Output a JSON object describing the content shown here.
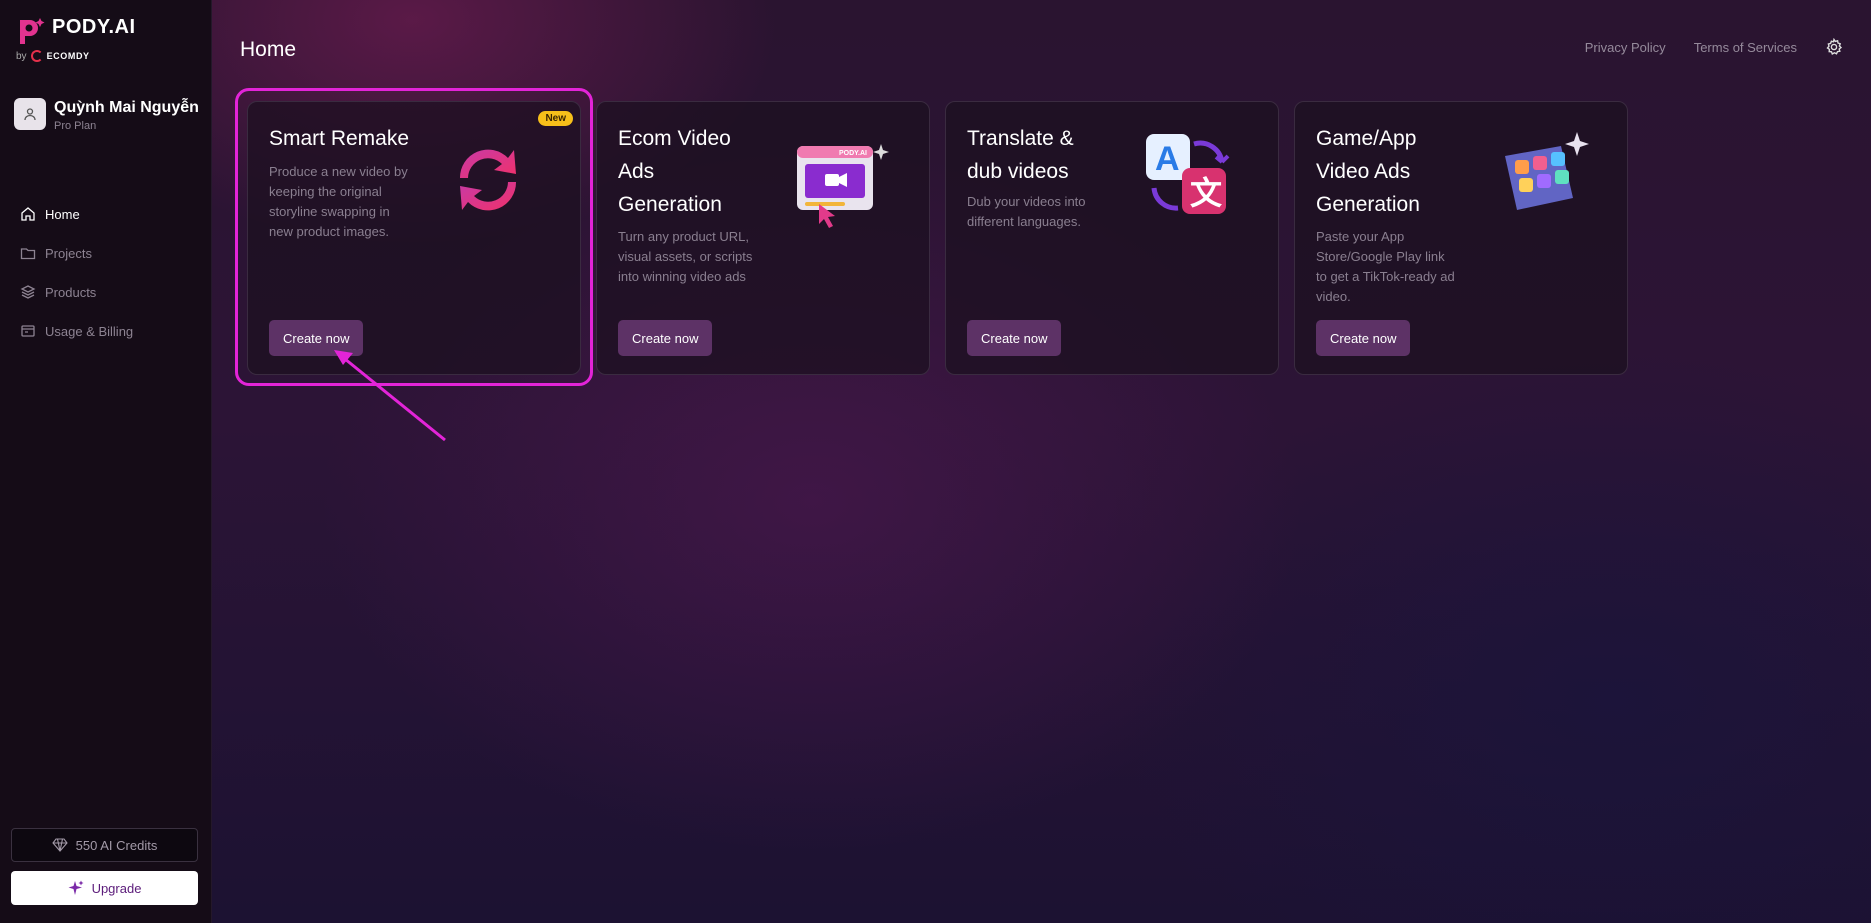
{
  "brand": {
    "name": "PODY.AI",
    "by": "by",
    "company": "ECOMDY"
  },
  "user": {
    "name": "Quỳnh Mai Nguyễn",
    "plan": "Pro Plan"
  },
  "nav": [
    {
      "label": "Home",
      "icon": "home-icon"
    },
    {
      "label": "Projects",
      "icon": "folder-icon"
    },
    {
      "label": "Products",
      "icon": "layers-icon"
    },
    {
      "label": "Usage & Billing",
      "icon": "billing-icon"
    }
  ],
  "credits": {
    "label": "550 AI Credits"
  },
  "upgrade": {
    "label": "Upgrade"
  },
  "header": {
    "title": "Home",
    "privacy": "Privacy Policy",
    "terms": "Terms of Services"
  },
  "cards": [
    {
      "title": "Smart Remake",
      "badge": "New",
      "desc": "Produce a new video by keeping the original storyline swapping in new product images.",
      "button": "Create now"
    },
    {
      "title": "Ecom Video Ads Generation",
      "desc": "Turn any product URL, visual assets, or scripts into winning video ads",
      "button": "Create now"
    },
    {
      "title": "Translate & dub videos",
      "desc": "Dub your videos into different languages.",
      "button": "Create now"
    },
    {
      "title": "Game/App Video Ads Generation",
      "desc": "Paste your App Store/Google Play link to get a TikTok-ready ad video.",
      "button": "Create now"
    }
  ],
  "colors": {
    "accent": "#5d3266",
    "highlight": "#e324d8",
    "badge": "#f7bf1a"
  }
}
